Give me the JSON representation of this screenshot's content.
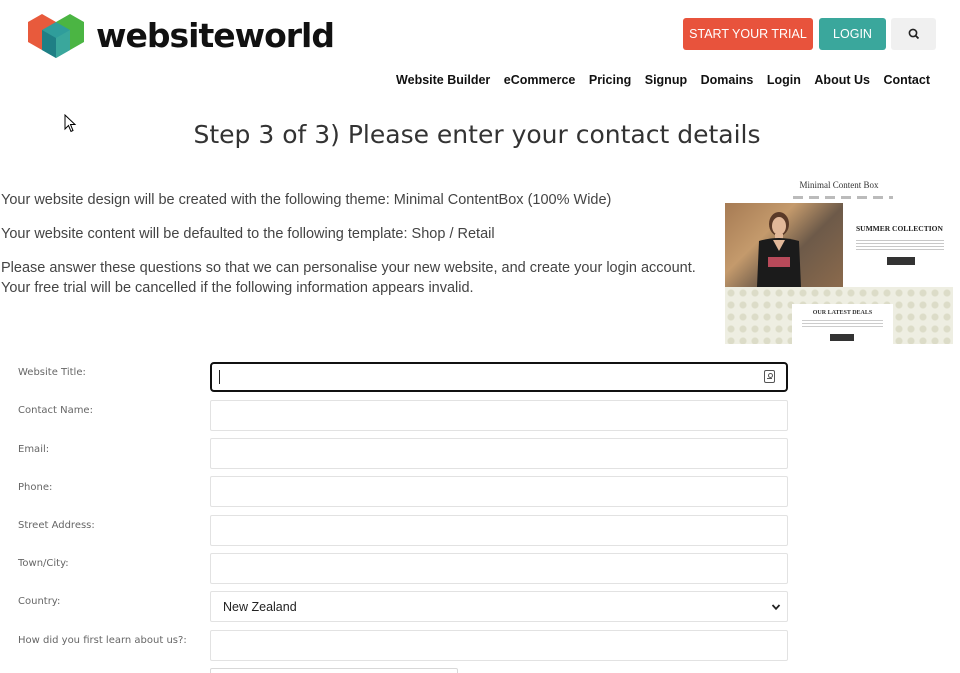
{
  "header": {
    "logo_text": "websiteworld",
    "trial_button": "START YOUR TRIAL",
    "login_button": "LOGIN",
    "search_icon": "search-icon",
    "nav": [
      "Website Builder",
      "eCommerce",
      "Pricing",
      "Signup",
      "Domains",
      "Login",
      "About Us",
      "Contact"
    ]
  },
  "colors": {
    "trial": "#e8533c",
    "login": "#3aa79c"
  },
  "page": {
    "title": "Step 3 of 3) Please enter your contact details",
    "theme_line": "Your website design will be created with the following theme: Minimal ContentBox (100% Wide)",
    "template_line": "Your website content will be defaulted to the following template: Shop / Retail",
    "notice_line": "Please answer these questions so that we can personalise your new website, and create your login account. Your free trial will be cancelled if the following information appears invalid."
  },
  "preview": {
    "title": "Minimal Content Box",
    "hero_heading": "SUMMER COLLECTION",
    "deals_heading": "OUR LATEST DEALS"
  },
  "form": {
    "labels": [
      "Website Title:",
      "Contact Name:",
      "Email:",
      "Phone:",
      "Street Address:",
      "Town/City:",
      "Country:",
      "How did you first learn about us?:"
    ],
    "values": {
      "website_title": "",
      "contact_name": "",
      "email": "",
      "phone": "",
      "street_address": "",
      "town_city": "",
      "learn_about": ""
    },
    "country_selected": "New Zealand"
  }
}
